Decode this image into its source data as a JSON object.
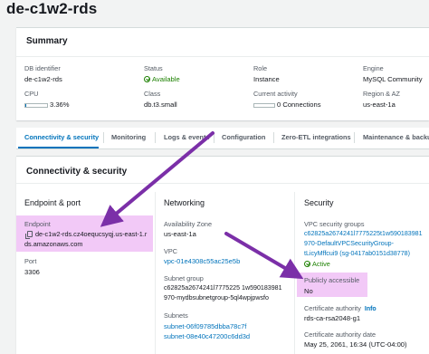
{
  "page": {
    "title": "de-c1w2-rds"
  },
  "summary": {
    "heading": "Summary",
    "db_identifier_label": "DB identifier",
    "db_identifier_value": "de-c1w2-rds",
    "status_label": "Status",
    "status_value": "Available",
    "role_label": "Role",
    "role_value": "Instance",
    "engine_label": "Engine",
    "engine_value": "MySQL Community",
    "cpu_label": "CPU",
    "cpu_value": "3.36%",
    "cpu_fraction": 0.0336,
    "class_label": "Class",
    "class_value": "db.t3.small",
    "activity_label": "Current activity",
    "activity_value": "0 Connections",
    "region_label": "Region & AZ",
    "region_value": "us-east-1a"
  },
  "tabs": [
    {
      "label": "Connectivity & security",
      "active": true
    },
    {
      "label": "Monitoring",
      "active": false
    },
    {
      "label": "Logs & events",
      "active": false
    },
    {
      "label": "Configuration",
      "active": false
    },
    {
      "label": "Zero-ETL integrations",
      "active": false
    },
    {
      "label": "Maintenance & backups",
      "active": false
    }
  ],
  "connectivity": {
    "heading": "Connectivity & security",
    "endpoint_port": {
      "heading": "Endpoint & port",
      "endpoint_label": "Endpoint",
      "endpoint_line1": "de-c1w2-rds.cz4oequcsyqj.us-east-1.r",
      "endpoint_line2": "ds.amazonaws.com",
      "port_label": "Port",
      "port_value": "3306"
    },
    "networking": {
      "heading": "Networking",
      "az_label": "Availability Zone",
      "az_value": "us-east-1a",
      "vpc_label": "VPC",
      "vpc_value": "vpc-01e4308c55ac25e5b",
      "subnet_group_label": "Subnet group",
      "subnet_group_line1": "c62825a2674241l7775225 1w590183981",
      "subnet_group_line2": "970-mydbsubnetgroup-5ql4wpjpwsfo",
      "subnets_label": "Subnets",
      "subnet_1": "subnet-06f09785dbba78c7f",
      "subnet_2": "subnet-08e40c47200c6dd3d"
    },
    "security": {
      "heading": "Security",
      "vpc_sg_label": "VPC security groups",
      "sg_line1": "c62825a2674241l7775225t1w590183981",
      "sg_line2": "970-DefaultVPCSecurityGroup-",
      "sg_line3": "tLicyMffcui9 (sg-0417ab0151d38778)",
      "sg_status": "Active",
      "public_label": "Publicly accessible",
      "public_value": "No",
      "ca_label": "Certificate authority",
      "ca_info": "Info",
      "ca_value": "rds-ca-rsa2048-g1",
      "ca_date_label": "Certificate authority date",
      "ca_date_value": "May 25, 2061, 16:34 (UTC-04:00)"
    }
  },
  "colors": {
    "link": "#0073bb",
    "success": "#1d8102",
    "highlight": "#f2c9f7",
    "annotation_arrow": "#7b2fa8"
  }
}
